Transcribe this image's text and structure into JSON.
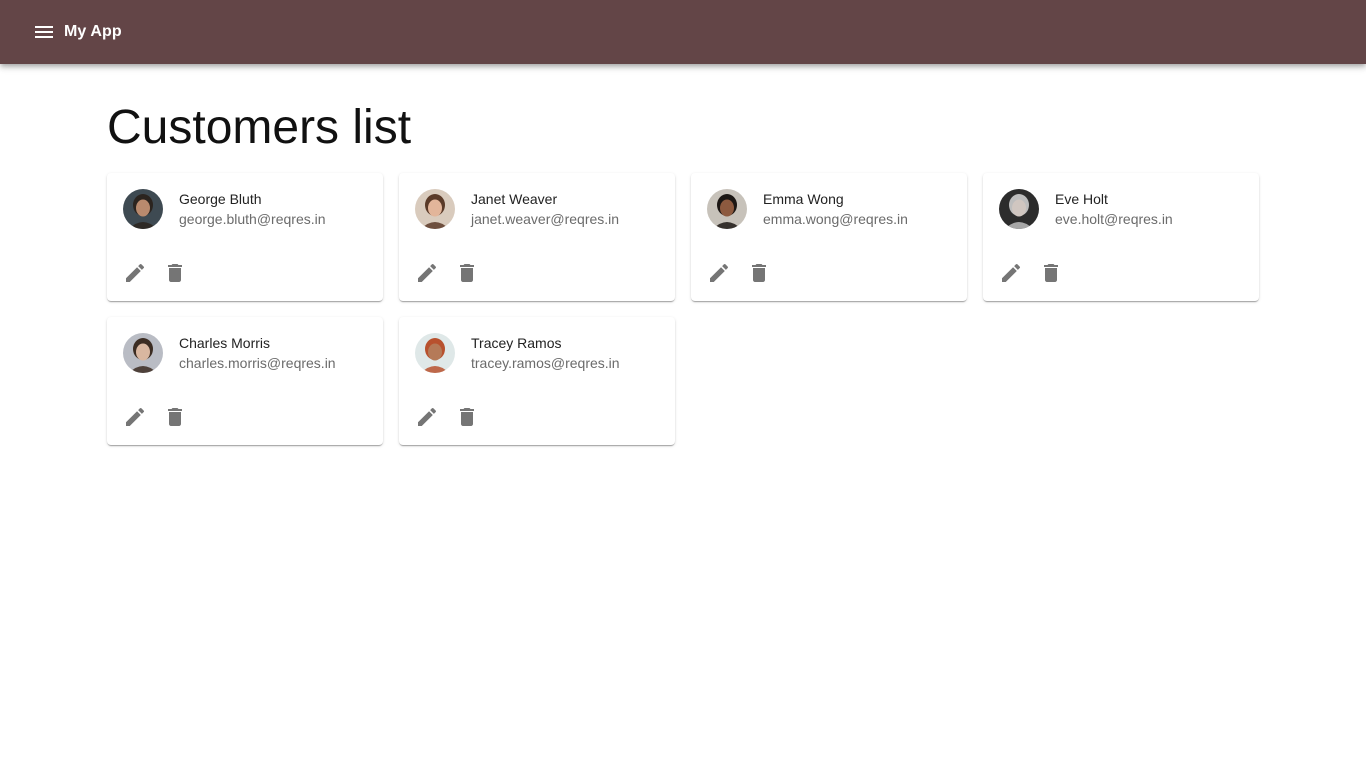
{
  "app": {
    "title": "My App",
    "brand_color": "#634547",
    "menu_icon": "menu-icon"
  },
  "page": {
    "title": "Customers list"
  },
  "customers": [
    {
      "name": "George Bluth",
      "email": "george.bluth@reqres.in",
      "avatar_bg": "#3e4a52",
      "skin": "#b98a6e",
      "hair": "#2b241f"
    },
    {
      "name": "Janet Weaver",
      "email": "janet.weaver@reqres.in",
      "avatar_bg": "#d9cbbd",
      "skin": "#e2b59a",
      "hair": "#5a3a28"
    },
    {
      "name": "Emma Wong",
      "email": "emma.wong@reqres.in",
      "avatar_bg": "#c7c2ba",
      "skin": "#8d5a3f",
      "hair": "#1c1714"
    },
    {
      "name": "Eve Holt",
      "email": "eve.holt@reqres.in",
      "avatar_bg": "#2c2c2c",
      "skin": "#d0c6c0",
      "hair": "#bdbdbd"
    },
    {
      "name": "Charles Morris",
      "email": "charles.morris@reqres.in",
      "avatar_bg": "#b9bcc4",
      "skin": "#d9b7a0",
      "hair": "#3b2c22"
    },
    {
      "name": "Tracey Ramos",
      "email": "tracey.ramos@reqres.in",
      "avatar_bg": "#dfe8e8",
      "skin": "#b57a58",
      "hair": "#b8512e"
    }
  ],
  "card_actions": {
    "edit_icon": "edit-icon",
    "delete_icon": "delete-icon",
    "icon_color": "#757575"
  }
}
